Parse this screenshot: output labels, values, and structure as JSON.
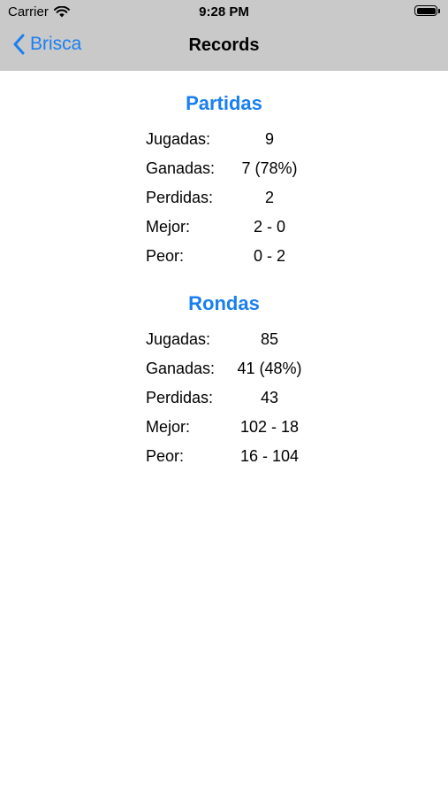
{
  "status_bar": {
    "carrier": "Carrier",
    "time": "9:28 PM",
    "wifi_icon": "wifi-icon",
    "battery_icon": "battery-icon"
  },
  "nav": {
    "back_label": "Brisca",
    "back_icon": "chevron-left-icon",
    "title": "Records"
  },
  "colors": {
    "accent": "#1a7ff0",
    "nav_background": "#c9c9c9"
  },
  "sections": [
    {
      "title": "Partidas",
      "rows": [
        {
          "label": "Jugadas:",
          "value": "9"
        },
        {
          "label": "Ganadas:",
          "value": "7 (78%)"
        },
        {
          "label": "Perdidas:",
          "value": "2"
        },
        {
          "label": "Mejor:",
          "value": "2 - 0"
        },
        {
          "label": "Peor:",
          "value": "0 - 2"
        }
      ]
    },
    {
      "title": "Rondas",
      "rows": [
        {
          "label": "Jugadas:",
          "value": "85"
        },
        {
          "label": "Ganadas:",
          "value": "41 (48%)"
        },
        {
          "label": "Perdidas:",
          "value": "43"
        },
        {
          "label": "Mejor:",
          "value": "102 - 18"
        },
        {
          "label": "Peor:",
          "value": "16 - 104"
        }
      ]
    }
  ]
}
